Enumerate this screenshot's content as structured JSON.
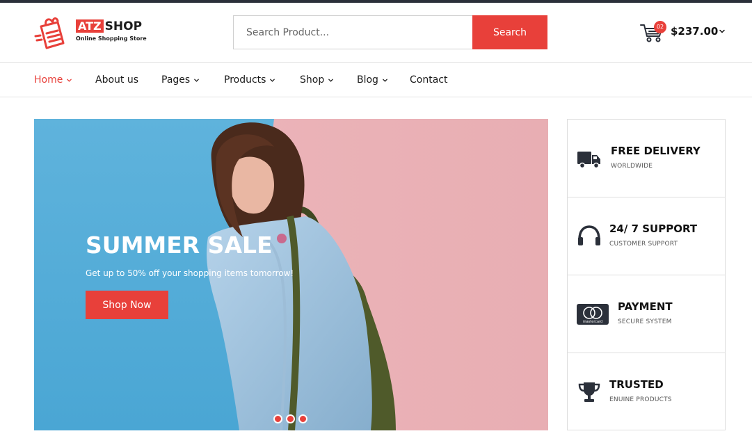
{
  "logo": {
    "brand_highlight": "ATZ",
    "brand_rest": "SHOP",
    "tagline": "Online Shopping Store"
  },
  "search": {
    "placeholder": "Search Product...",
    "button_label": "Search"
  },
  "cart": {
    "count": "02",
    "total": "$237.00"
  },
  "nav": {
    "items": [
      {
        "label": "Home",
        "active": true,
        "dropdown": true
      },
      {
        "label": "About us",
        "active": false,
        "dropdown": false
      },
      {
        "label": "Pages",
        "active": false,
        "dropdown": true
      },
      {
        "label": "Products",
        "active": false,
        "dropdown": true
      },
      {
        "label": "Shop",
        "active": false,
        "dropdown": true
      },
      {
        "label": "Blog",
        "active": false,
        "dropdown": true
      },
      {
        "label": "Contact",
        "active": false,
        "dropdown": false
      }
    ]
  },
  "hero": {
    "title": "SUMMER SALE",
    "subtitle": "Get up to 50% off your shopping items tomorrow!",
    "cta_label": "Shop Now",
    "slide_count": 3
  },
  "features": [
    {
      "icon": "truck-icon",
      "title": "FREE DELIVERY",
      "subtitle": "WORLDWIDE"
    },
    {
      "icon": "headphones-icon",
      "title": "24/ 7 SUPPORT",
      "subtitle": "CUSTOMER SUPPORT"
    },
    {
      "icon": "mastercard-icon",
      "title": "PAYMENT",
      "subtitle": "SECURE SYSTEM",
      "card_text": "mastercard"
    },
    {
      "icon": "trophy-icon",
      "title": "TRUSTED",
      "subtitle": "ENUINE PRODUCTS"
    }
  ],
  "colors": {
    "accent": "#e8403a",
    "dark": "#2b303a",
    "hero_blue": "#5fb3dc",
    "hero_pink": "#eab0b5"
  }
}
